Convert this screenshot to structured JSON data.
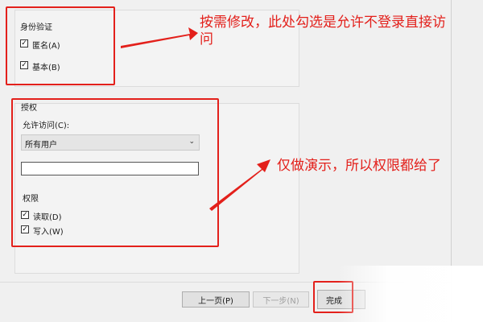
{
  "auth_group": {
    "title": "身份验证",
    "anonymous": {
      "label": "匿名(A)",
      "checked": true
    },
    "basic": {
      "label": "基本(B)",
      "checked": true
    }
  },
  "authorization_group": {
    "title": "授权",
    "allow_access_label": "允许访问(C):",
    "allow_access_value": "所有用户",
    "user_field_value": "",
    "permissions_title": "权限",
    "read": {
      "label": "读取(D)",
      "checked": true
    },
    "write": {
      "label": "写入(W)",
      "checked": true
    }
  },
  "annotations": {
    "note_top": "按需修改，此处勾选是允许不登录直接访问",
    "note_middle": "仅做演示，所以权限都给了"
  },
  "footer": {
    "prev_label": "上一页(P)",
    "next_label": "下一步(N)",
    "finish_label": "完成"
  },
  "colors": {
    "annotation": "#e3201b",
    "dialog_bg": "#f0f0f0"
  }
}
